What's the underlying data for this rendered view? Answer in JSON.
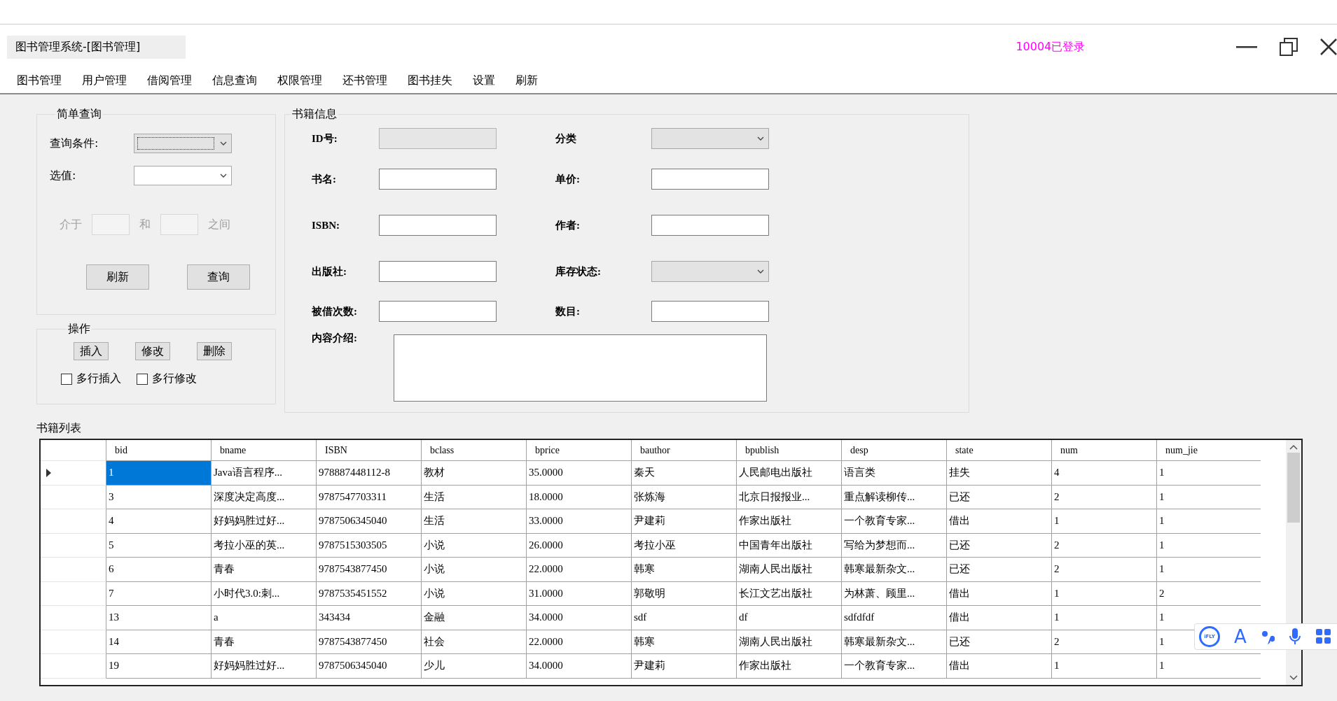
{
  "window": {
    "title": "图书管理系统-[图书管理]",
    "login_status": "10004已登录"
  },
  "menu": [
    "图书管理",
    "用户管理",
    "借阅管理",
    "信息查询",
    "权限管理",
    "还书管理",
    "图书挂失",
    "设置",
    "刷新"
  ],
  "simple_query": {
    "title": "简单查询",
    "condition_label": "查询条件:",
    "value_label": "选值:",
    "range_from": "介于",
    "range_and": "和",
    "range_between": "之间",
    "range_disabled": true,
    "buttons": [
      "刷新",
      "查询"
    ]
  },
  "operations": {
    "title": "操作",
    "buttons": [
      "插入",
      "修改",
      "删除"
    ],
    "checkboxes": [
      {
        "label": "多行插入",
        "checked": false
      },
      {
        "label": "多行修改",
        "checked": false
      }
    ]
  },
  "book_info": {
    "title": "书籍信息",
    "fields": [
      {
        "label": "ID号:",
        "kind": "text",
        "disabled": true
      },
      {
        "label": "分类",
        "kind": "combo",
        "disabled": true
      },
      {
        "label": "书名:",
        "kind": "text",
        "disabled": false
      },
      {
        "label": "单价:",
        "kind": "text",
        "disabled": false
      },
      {
        "label": "ISBN:",
        "kind": "text",
        "disabled": false
      },
      {
        "label": "作者:",
        "kind": "text",
        "disabled": false
      },
      {
        "label": "出版社:",
        "kind": "text",
        "disabled": false
      },
      {
        "label": "库存状态:",
        "kind": "combo",
        "disabled": true
      },
      {
        "label": "被借次数:",
        "kind": "text",
        "disabled": false
      },
      {
        "label": "数目:",
        "kind": "text",
        "disabled": false
      }
    ],
    "description_label": "内容介绍:"
  },
  "book_list": {
    "title": "书籍列表",
    "columns": [
      "bid",
      "bname",
      "ISBN",
      "bclass",
      "bprice",
      "bauthor",
      "bpublish",
      "desp",
      "state",
      "num",
      "num_jie"
    ],
    "rows": [
      {
        "selected": true,
        "cells": [
          "1",
          "Java语言程序...",
          "978887448112-8",
          "教材",
          "35.0000",
          "秦天",
          "人民邮电出版社",
          "语言类",
          "挂失",
          "4",
          "1"
        ]
      },
      {
        "selected": false,
        "cells": [
          "3",
          "深度决定高度...",
          "9787547703311",
          "生活",
          "18.0000",
          "张炼海",
          "北京日报报业...",
          "重点解读柳传...",
          "已还",
          "2",
          "1"
        ]
      },
      {
        "selected": false,
        "cells": [
          "4",
          "好妈妈胜过好...",
          "9787506345040",
          "生活",
          "33.0000",
          "尹建莉",
          "作家出版社",
          "一个教育专家...",
          "借出",
          "1",
          "1"
        ]
      },
      {
        "selected": false,
        "cells": [
          "5",
          "考拉小巫的英...",
          "9787515303505",
          "小说",
          "26.0000",
          "考拉小巫",
          "中国青年出版社",
          "写给为梦想而...",
          "已还",
          "2",
          "1"
        ]
      },
      {
        "selected": false,
        "cells": [
          "6",
          "青春",
          "9787543877450",
          "小说",
          "22.0000",
          "韩寒",
          "湖南人民出版社",
          "韩寒最新杂文...",
          "已还",
          "2",
          "1"
        ]
      },
      {
        "selected": false,
        "cells": [
          "7",
          "小时代3.0:刺...",
          "9787535451552",
          "小说",
          "31.0000",
          "郭敬明",
          "长江文艺出版社",
          "为林萧、顾里...",
          "借出",
          "1",
          "2"
        ]
      },
      {
        "selected": false,
        "cells": [
          "13",
          "a",
          "343434",
          "金融",
          "34.0000",
          "sdf",
          "df",
          "sdfdfdf",
          "借出",
          "1",
          "1"
        ]
      },
      {
        "selected": false,
        "cells": [
          "14",
          "青春",
          "9787543877450",
          "社会",
          "22.0000",
          "韩寒",
          "湖南人民出版社",
          "韩寒最新杂文...",
          "已还",
          "2",
          "1"
        ]
      },
      {
        "selected": false,
        "cells": [
          "19",
          "好妈妈胜过好...",
          "9787506345040",
          "少儿",
          "34.0000",
          "尹建莉",
          "作家出版社",
          "一个教育专家...",
          "借出",
          "1",
          "1"
        ]
      }
    ]
  },
  "ime_toolbar": {
    "logo": "iFLY",
    "letter": "A"
  }
}
